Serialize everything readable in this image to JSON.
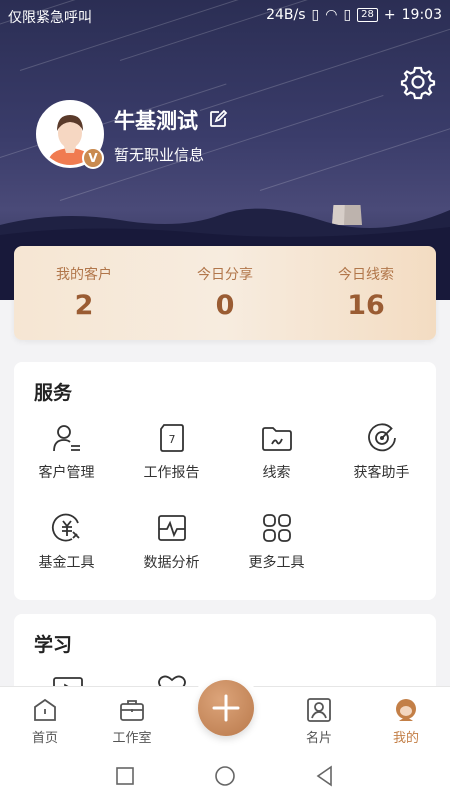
{
  "status": {
    "carrier": "仅限紧急呼叫",
    "speed": "24B/s",
    "battery": "28",
    "time": "19:03"
  },
  "profile": {
    "name": "牛基测试",
    "subtitle": "暂无职业信息",
    "badge": "V"
  },
  "stats": [
    {
      "label": "我的客户",
      "value": "2"
    },
    {
      "label": "今日分享",
      "value": "0"
    },
    {
      "label": "今日线索",
      "value": "16"
    }
  ],
  "services": {
    "title": "服务",
    "items": [
      {
        "label": "客户管理",
        "icon": "customer-manage-icon"
      },
      {
        "label": "工作报告",
        "icon": "calendar-report-icon"
      },
      {
        "label": "线索",
        "icon": "folder-lead-icon"
      },
      {
        "label": "获客助手",
        "icon": "radar-icon"
      },
      {
        "label": "基金工具",
        "icon": "fund-icon"
      },
      {
        "label": "数据分析",
        "icon": "chart-pulse-icon"
      },
      {
        "label": "更多工具",
        "icon": "grid-more-icon"
      }
    ],
    "report_day": "7"
  },
  "learning": {
    "title": "学习"
  },
  "nav": {
    "home": "首页",
    "studio": "工作室",
    "card": "名片",
    "mine": "我的"
  },
  "colors": {
    "accent": "#c37f47",
    "header": "#2b2e54"
  }
}
